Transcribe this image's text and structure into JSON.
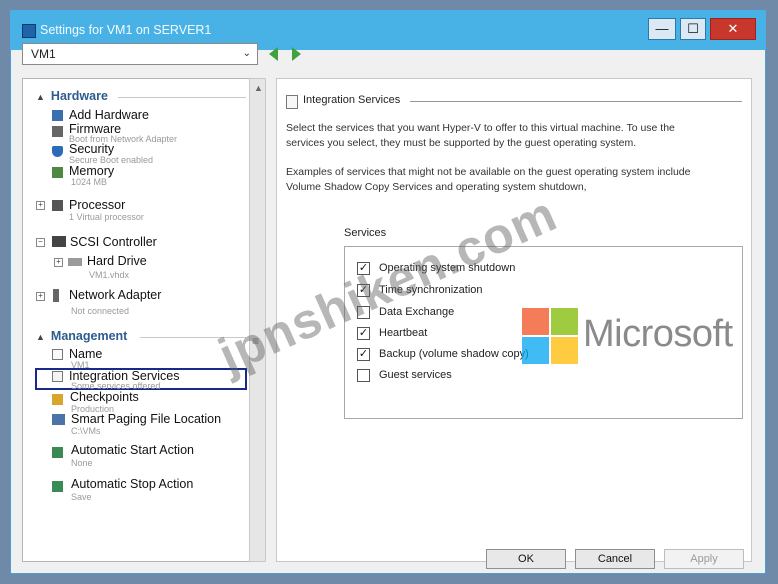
{
  "window": {
    "title": "Settings for VM1 on SERVER1",
    "min_glyph": "—",
    "max_glyph": "☐",
    "close_glyph": "✕"
  },
  "vm_selector": {
    "value": "VM1",
    "chevron": "⌄"
  },
  "tree": {
    "hardware_header": "Hardware",
    "management_header": "Management",
    "items": [
      {
        "label": "Add Hardware",
        "sub": ""
      },
      {
        "label": "Firmware",
        "sub": "Boot from Network Adapter"
      },
      {
        "label": "Security",
        "sub": "Secure Boot enabled"
      },
      {
        "label": "Memory",
        "sub": "1024 MB"
      },
      {
        "label": "Processor",
        "sub": "1 Virtual processor"
      },
      {
        "label": "SCSI Controller",
        "sub": ""
      },
      {
        "label": "Hard Drive",
        "sub": "VM1.vhdx"
      },
      {
        "label": "Network Adapter",
        "sub": "Not connected"
      },
      {
        "label": "Name",
        "sub": "VM1"
      },
      {
        "label": "Integration Services",
        "sub": "Some services offered"
      },
      {
        "label": "Checkpoints",
        "sub": "Production"
      },
      {
        "label": "Smart Paging File Location",
        "sub": "C:\\VMs"
      },
      {
        "label": "Automatic Start Action",
        "sub": "None"
      },
      {
        "label": "Automatic Stop Action",
        "sub": "Save"
      }
    ]
  },
  "panel": {
    "title": "Integration Services",
    "desc1_line1": "Select the services that you want Hyper-V to offer to this virtual machine. To use the",
    "desc1_line2": "services you select, they must be supported by the guest operating system.",
    "desc2_line1": "Examples of services that might not be available on the guest operating system include",
    "desc2_line2": "Volume Shadow Copy Services and operating system shutdown,",
    "services_label": "Services",
    "services": [
      {
        "label": "Operating system shutdown",
        "checked": true,
        "mark": "✓"
      },
      {
        "label": "Time synchronization",
        "checked": true,
        "mark": "✓"
      },
      {
        "label": "Data Exchange",
        "checked": false,
        "mark": ""
      },
      {
        "label": "Heartbeat",
        "checked": true,
        "mark": "✓"
      },
      {
        "label": "Backup (volume shadow copy)",
        "checked": true,
        "mark": "✓"
      },
      {
        "label": "Guest services",
        "checked": false,
        "mark": ""
      }
    ]
  },
  "buttons": {
    "ok": "OK",
    "cancel": "Cancel",
    "apply": "Apply"
  },
  "overlay": {
    "microsoft_text": "Microsoft",
    "watermark": "jpnshiken.com",
    "logo_colors": [
      "#f25022",
      "#7fba00",
      "#00a4ef",
      "#ffb900"
    ]
  }
}
